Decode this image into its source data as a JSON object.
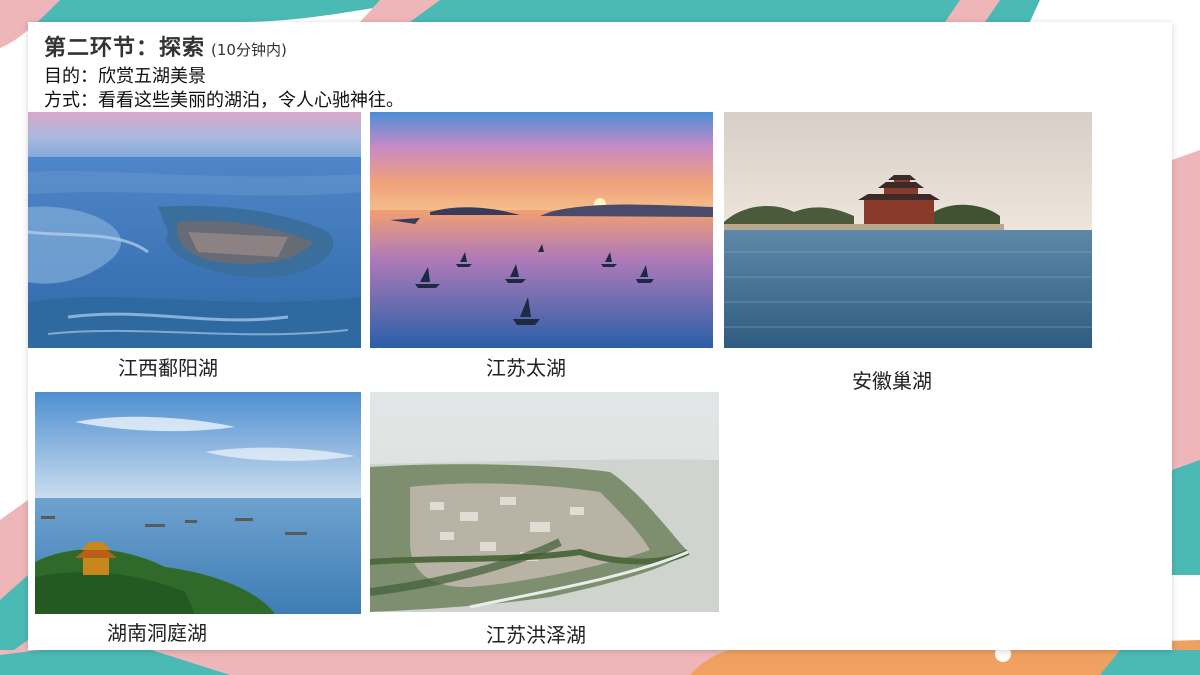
{
  "header": {
    "title": "第二环节：探索",
    "time_note": "(10分钟内)",
    "purpose": "目的：欣赏五湖美景",
    "method": "方式：看看这些美丽的湖泊，令人心驰神往。"
  },
  "lakes": [
    {
      "caption": "江西鄱阳湖"
    },
    {
      "caption": "江苏太湖"
    },
    {
      "caption": "安徽巢湖"
    },
    {
      "caption": "湖南洞庭湖"
    },
    {
      "caption": "江苏洪泽湖"
    }
  ],
  "colors": {
    "teal": "#4bbab5",
    "pink": "#efb6b9",
    "orange": "#f0a060",
    "navy": "#2d3550"
  }
}
